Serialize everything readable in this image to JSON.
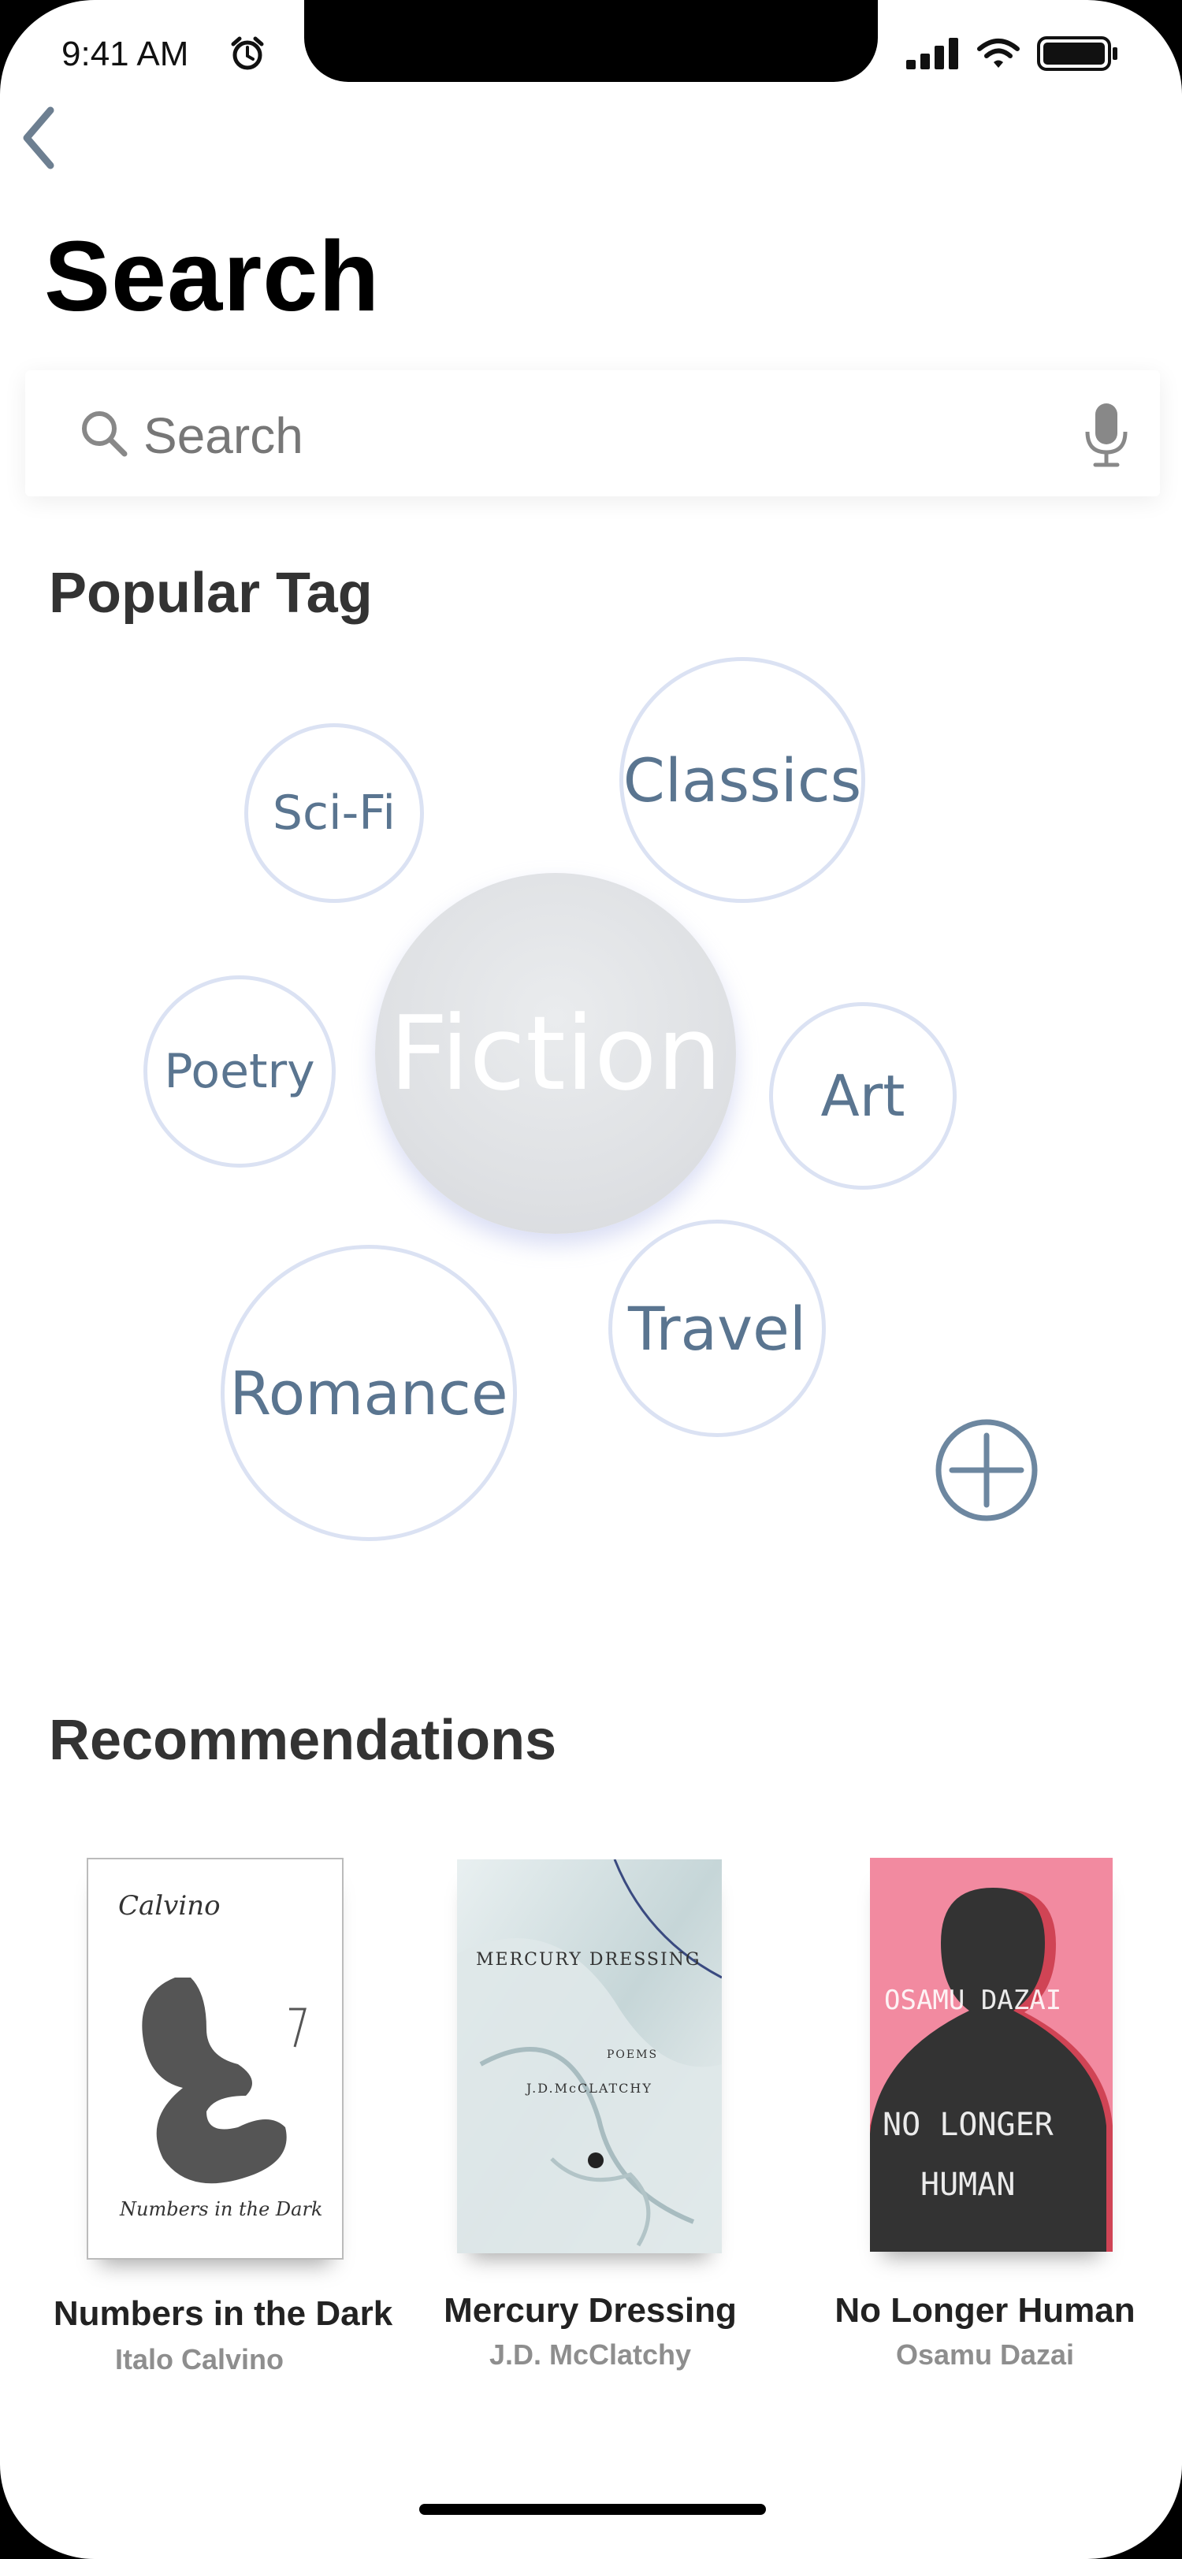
{
  "status_bar": {
    "time": "9:41 AM"
  },
  "header": {
    "title": "Search"
  },
  "search": {
    "placeholder": "Search"
  },
  "popular": {
    "title": "Popular Tag",
    "tags": [
      {
        "label": "Sci-Fi"
      },
      {
        "label": "Classics"
      },
      {
        "label": "Poetry"
      },
      {
        "label": "Fiction",
        "selected": true
      },
      {
        "label": "Art"
      },
      {
        "label": "Romance"
      },
      {
        "label": "Travel"
      }
    ]
  },
  "recommendations": {
    "title": "Recommendations",
    "books": [
      {
        "title": "Numbers in the Dark",
        "author": "Italo Calvino",
        "cover_author": "Calvino",
        "cover_title": "Numbers in the Dark"
      },
      {
        "title": "Mercury Dressing",
        "author": "J.D. McClatchy",
        "cover_title": "MERCURY DRESSING",
        "cover_sub": "POEMS",
        "cover_author": "J.D.McCLATCHY"
      },
      {
        "title": "No Longer Human",
        "author": "Osamu Dazai",
        "cover_author": "OSAMU DAZAI",
        "cover_title_1": "NO LONGER",
        "cover_title_2": "HUMAN"
      }
    ]
  },
  "colors": {
    "accent": "#5a7590",
    "bubble_border": "#dbe2f3",
    "dazai_cover": "#f28aa0"
  }
}
